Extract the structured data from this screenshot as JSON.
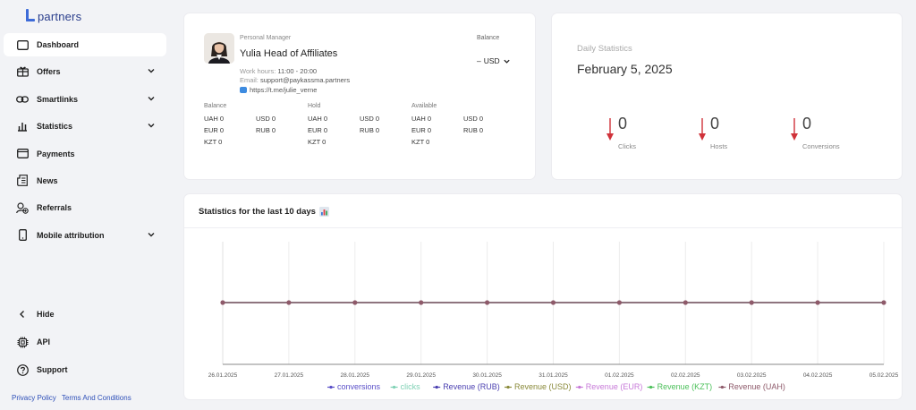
{
  "brand": {
    "name": "partners"
  },
  "sidebar": {
    "items": [
      {
        "label": "Dashboard",
        "icon": "dashboard-icon",
        "has_chevron": false,
        "active": true
      },
      {
        "label": "Offers",
        "icon": "offers-icon",
        "has_chevron": true,
        "active": false
      },
      {
        "label": "Smartlinks",
        "icon": "link-icon",
        "has_chevron": true,
        "active": false
      },
      {
        "label": "Statistics",
        "icon": "bar-chart-icon",
        "has_chevron": true,
        "active": false
      },
      {
        "label": "Payments",
        "icon": "wallet-icon",
        "has_chevron": false,
        "active": false
      },
      {
        "label": "News",
        "icon": "news-icon",
        "has_chevron": false,
        "active": false
      },
      {
        "label": "Referrals",
        "icon": "referrals-icon",
        "has_chevron": false,
        "active": false
      },
      {
        "label": "Mobile attribution",
        "icon": "mobile-icon",
        "has_chevron": true,
        "active": false
      }
    ],
    "bottom_items": [
      {
        "label": "Hide",
        "icon": "chevron-left-icon"
      },
      {
        "label": "API",
        "icon": "chip-icon"
      },
      {
        "label": "Support",
        "icon": "help-icon"
      }
    ],
    "footer": {
      "privacy": "Privacy Policy",
      "terms": "Terms And Conditions"
    }
  },
  "manager": {
    "caption": "Personal Manager",
    "name": "Yulia Head of Affiliates",
    "work_hours_label": "Work hours:",
    "work_hours": "11:00 - 20:00",
    "email_label": "Email:",
    "email": "support@paykassma.partners",
    "telegram": "https://t.me/julie_verne"
  },
  "balance": {
    "caption": "Balance",
    "amount": "–",
    "currency": "USD",
    "groups": [
      {
        "title": "Balance",
        "rows": [
          [
            "UAH 0",
            "USD 0"
          ],
          [
            "EUR 0",
            "RUB 0"
          ],
          [
            "KZT 0",
            ""
          ]
        ]
      },
      {
        "title": "Hold",
        "rows": [
          [
            "UAH 0",
            "USD 0"
          ],
          [
            "EUR 0",
            "RUB 0"
          ],
          [
            "KZT 0",
            ""
          ]
        ]
      },
      {
        "title": "Available",
        "rows": [
          [
            "UAH 0",
            "USD 0"
          ],
          [
            "EUR 0",
            "RUB 0"
          ],
          [
            "KZT 0",
            ""
          ]
        ]
      }
    ]
  },
  "daily": {
    "caption": "Daily Statistics",
    "date": "February 5, 2025",
    "metrics": [
      {
        "value": "0",
        "label": "Clicks"
      },
      {
        "value": "0",
        "label": "Hosts"
      },
      {
        "value": "0",
        "label": "Conversions"
      }
    ],
    "arrow_color": "#d0323a"
  },
  "stats": {
    "title": "Statistics for the last 10 days",
    "icon": "bar-chart-emoji-icon"
  },
  "chart_data": {
    "type": "line",
    "x": [
      "26.01.2025",
      "27.01.2025",
      "28.01.2025",
      "29.01.2025",
      "30.01.2025",
      "31.01.2025",
      "01.02.2025",
      "02.02.2025",
      "03.02.2025",
      "04.02.2025",
      "05.02.2025"
    ],
    "series": [
      {
        "name": "conversions",
        "color": "#5a4fc8",
        "values": [
          0,
          0,
          0,
          0,
          0,
          0,
          0,
          0,
          0,
          0,
          0
        ]
      },
      {
        "name": "clicks",
        "color": "#7fd1b4",
        "values": [
          0,
          0,
          0,
          0,
          0,
          0,
          0,
          0,
          0,
          0,
          0
        ]
      },
      {
        "name": "Revenue (RUB)",
        "color": "#4a3fb0",
        "values": [
          0,
          0,
          0,
          0,
          0,
          0,
          0,
          0,
          0,
          0,
          0
        ]
      },
      {
        "name": "Revenue (USD)",
        "color": "#8a8a3a",
        "values": [
          0,
          0,
          0,
          0,
          0,
          0,
          0,
          0,
          0,
          0,
          0
        ]
      },
      {
        "name": "Revenue (EUR)",
        "color": "#c77ad8",
        "values": [
          0,
          0,
          0,
          0,
          0,
          0,
          0,
          0,
          0,
          0,
          0
        ]
      },
      {
        "name": "Revenue (KZT)",
        "color": "#4cc05a",
        "values": [
          0,
          0,
          0,
          0,
          0,
          0,
          0,
          0,
          0,
          0,
          0
        ]
      },
      {
        "name": "Revenue (UAH)",
        "color": "#8e5a6a",
        "values": [
          0,
          0,
          0,
          0,
          0,
          0,
          0,
          0,
          0,
          0,
          0
        ]
      }
    ],
    "grid": true,
    "legend_position": "bottom"
  }
}
